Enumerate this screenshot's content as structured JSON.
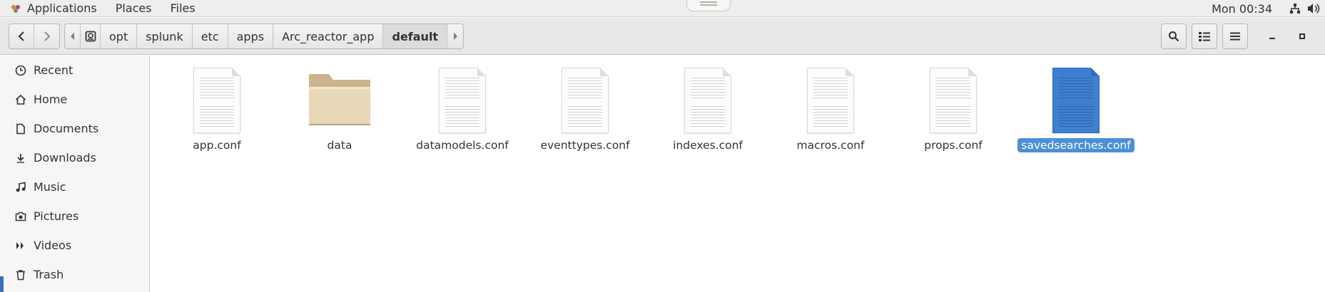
{
  "top_panel": {
    "menus": [
      "Applications",
      "Places",
      "Files"
    ],
    "clock": "Mon 00:34",
    "tray_icons": [
      "network-icon",
      "volume-icon"
    ]
  },
  "header": {
    "path": [
      "opt",
      "splunk",
      "etc",
      "apps",
      "Arc_reactor_app",
      "default"
    ],
    "active_crumb": "default"
  },
  "sidebar": {
    "items": [
      {
        "label": "Recent",
        "icon": "clock-icon"
      },
      {
        "label": "Home",
        "icon": "home-icon"
      },
      {
        "label": "Documents",
        "icon": "document-icon"
      },
      {
        "label": "Downloads",
        "icon": "download-icon"
      },
      {
        "label": "Music",
        "icon": "music-icon"
      },
      {
        "label": "Pictures",
        "icon": "camera-icon"
      },
      {
        "label": "Videos",
        "icon": "video-icon"
      },
      {
        "label": "Trash",
        "icon": "trash-icon"
      }
    ]
  },
  "files": [
    {
      "name": "app.conf",
      "type": "text"
    },
    {
      "name": "data",
      "type": "folder"
    },
    {
      "name": "datamodels.conf",
      "type": "text"
    },
    {
      "name": "eventtypes.conf",
      "type": "text"
    },
    {
      "name": "indexes.conf",
      "type": "text"
    },
    {
      "name": "macros.conf",
      "type": "text"
    },
    {
      "name": "props.conf",
      "type": "text"
    },
    {
      "name": "savedsearches.conf",
      "type": "text",
      "selected": true
    }
  ],
  "colors": {
    "selection": "#4a90d9",
    "folder": "#e8d8b8",
    "accent": "#3a6fb5"
  }
}
